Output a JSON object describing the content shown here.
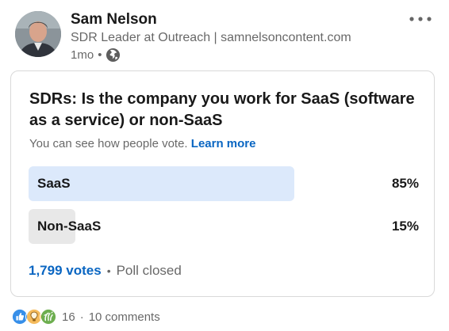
{
  "author": {
    "name": "Sam Nelson",
    "headline": "SDR Leader at Outreach | samnelsoncontent.com",
    "time": "1mo",
    "meta_separator": "•"
  },
  "poll": {
    "question": "SDRs: Is the company you work for SaaS (software as a service) or non-SaaS",
    "visibility_text": "You can see how people vote.",
    "learn_more": "Learn more",
    "options": [
      {
        "label": "SaaS",
        "percent_text": "85%",
        "percent": 85
      },
      {
        "label": "Non-SaaS",
        "percent_text": "15%",
        "percent": 15
      }
    ],
    "votes": "1,799 votes",
    "separator": "•",
    "status": "Poll closed"
  },
  "social": {
    "reactions": [
      "like-icon",
      "insightful-icon",
      "celebrate-icon"
    ],
    "reaction_count": "16",
    "separator": "·",
    "comments": "10 comments"
  },
  "colors": {
    "accent": "#0a66c2",
    "leading_option_bar": "#dce9fb",
    "other_option_bar": "#e8e8e8",
    "like": "#378fe9",
    "insightful": "#f5bb5c",
    "celebrate": "#6dae4f"
  }
}
